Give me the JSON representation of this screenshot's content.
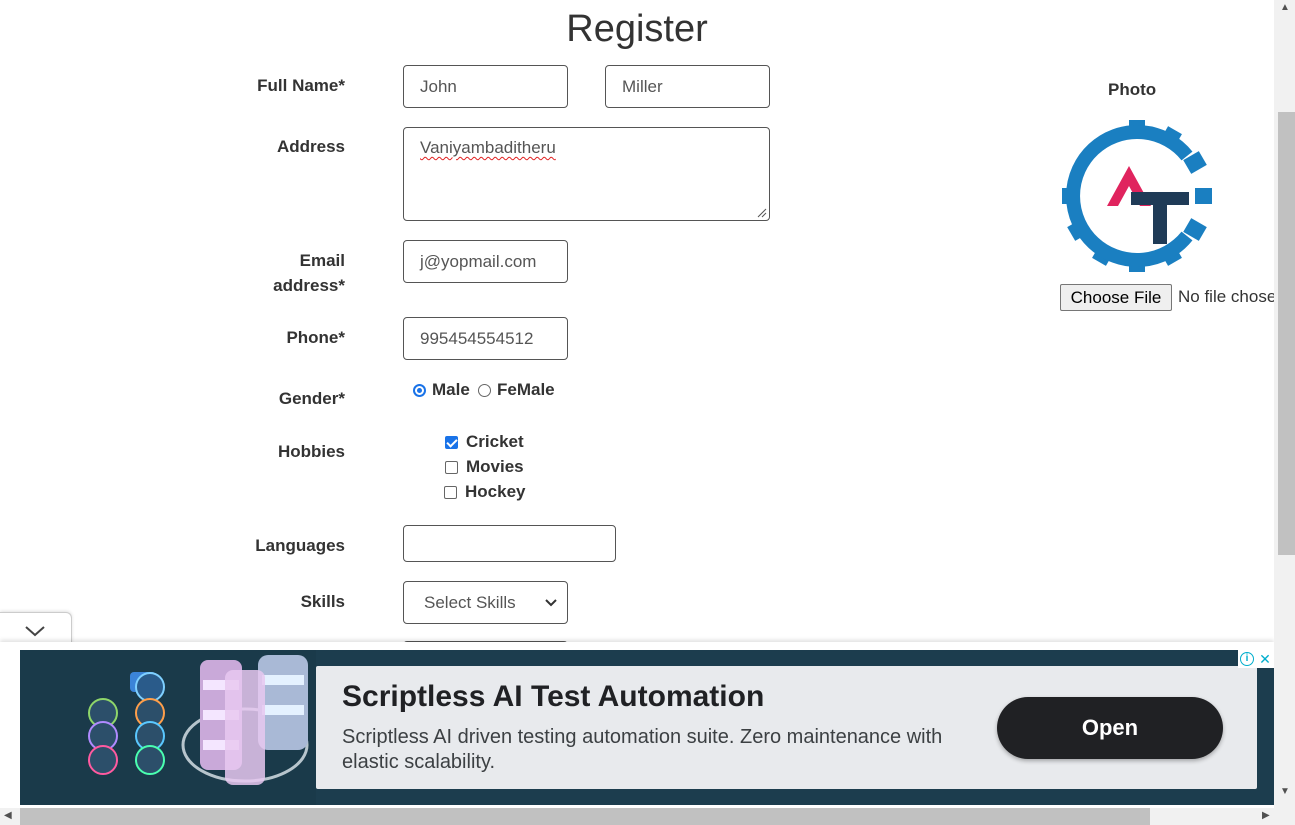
{
  "form": {
    "title": "Register",
    "labels": {
      "full_name": "Full Name*",
      "address": "Address",
      "email_line1": "Email",
      "email_line2": "address*",
      "phone": "Phone*",
      "gender": "Gender*",
      "hobbies": "Hobbies",
      "languages": "Languages",
      "skills": "Skills"
    },
    "first_name": "John",
    "last_name": "Miller",
    "address": "Vaniyambaditheru",
    "email": "j@yopmail.com",
    "phone": "995454554512",
    "gender_options": [
      {
        "label": "Male",
        "selected": true
      },
      {
        "label": "FeMale",
        "selected": false
      }
    ],
    "hobbies": [
      {
        "label": "Cricket",
        "checked": true
      },
      {
        "label": "Movies",
        "checked": false
      },
      {
        "label": "Hockey",
        "checked": false
      }
    ],
    "languages": "",
    "skills_selected": "Select Skills"
  },
  "photo": {
    "label": "Photo",
    "choose_file": "Choose File",
    "file_status": "No file chosen",
    "logo_colors": {
      "gear": "#1a7fc1",
      "a": "#e0245e",
      "t": "#1f3b57"
    }
  },
  "ad": {
    "title": "Scriptless AI Test Automation",
    "description": "Scriptless AI driven testing automation suite. Zero maintenance with elastic scalability.",
    "cta": "Open",
    "info_icon": "i",
    "close_icon": "✕"
  },
  "colors": {
    "accent": "#1a73e8",
    "ad_bg": "#1c3d4e"
  }
}
